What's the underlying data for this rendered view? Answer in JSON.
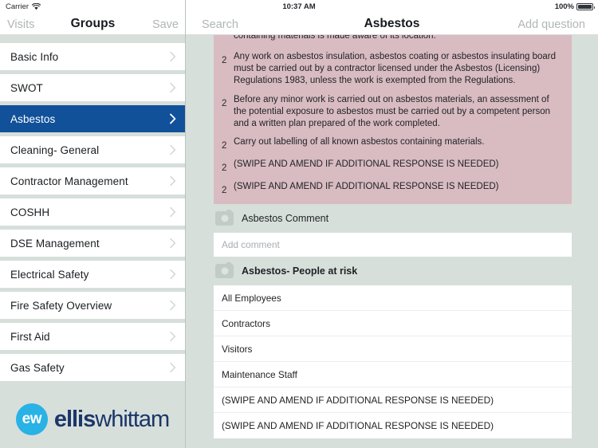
{
  "status_bar": {
    "carrier": "Carrier",
    "wifi_icon": "wifi-icon",
    "time": "10:37 AM",
    "battery_percent": "100%",
    "battery_icon": "battery-full-icon"
  },
  "sidebar": {
    "nav": {
      "back_label": "Visits",
      "title": "Groups",
      "save_label": "Save"
    },
    "items": [
      {
        "label": "Basic Info",
        "selected": false
      },
      {
        "label": "SWOT",
        "selected": false
      },
      {
        "label": "Asbestos",
        "selected": true
      },
      {
        "label": "Cleaning- General",
        "selected": false
      },
      {
        "label": "Contractor Management",
        "selected": false
      },
      {
        "label": "COSHH",
        "selected": false
      },
      {
        "label": "DSE Management",
        "selected": false
      },
      {
        "label": "Electrical Safety",
        "selected": false
      },
      {
        "label": "Fire Safety Overview",
        "selected": false
      },
      {
        "label": "First Aid",
        "selected": false
      },
      {
        "label": "Gas Safety",
        "selected": false
      }
    ],
    "logo": {
      "badge_text": "ew",
      "word_bold": "ellis",
      "word_light": "whittam",
      "badge_color": "#29b2e6",
      "word_color": "#1b3668"
    }
  },
  "detail": {
    "nav": {
      "search_label": "Search",
      "title": "Asbestos",
      "add_question_label": "Add question"
    },
    "answer_block": {
      "background_color": "#d8bcc2",
      "clipped_top_text": "containing materials is made aware of its location.",
      "rows": [
        {
          "number": "2",
          "text": "Any work on asbestos insulation, asbestos coating or asbestos insulating board must be carried out by a contractor licensed under the Asbestos (Licensing) Regulations 1983, unless the work is exempted from the Regulations."
        },
        {
          "number": "2",
          "text": "Before any minor work is carried out on asbestos materials, an assessment of the potential exposure to asbestos must be carried out by a competent person and a written plan prepared of the work completed."
        },
        {
          "number": "2",
          "text": "Carry out labelling of all known asbestos containing materials."
        },
        {
          "number": "2",
          "text": "(SWIPE AND AMEND IF ADDITIONAL RESPONSE IS NEEDED)"
        },
        {
          "number": "2",
          "text": "(SWIPE AND AMEND IF ADDITIONAL RESPONSE IS NEEDED)"
        }
      ]
    },
    "comment_section": {
      "camera_icon": "camera-icon",
      "title": "Asbestos Comment",
      "input_placeholder": "Add comment",
      "input_value": ""
    },
    "people_section": {
      "camera_icon": "camera-icon",
      "title": "Asbestos- People at risk",
      "rows": [
        "All Employees",
        "Contractors",
        "Visitors",
        "Maintenance Staff",
        "(SWIPE AND AMEND IF ADDITIONAL RESPONSE IS NEEDED)",
        "(SWIPE AND AMEND IF ADDITIONAL RESPONSE IS NEEDED)"
      ]
    }
  }
}
